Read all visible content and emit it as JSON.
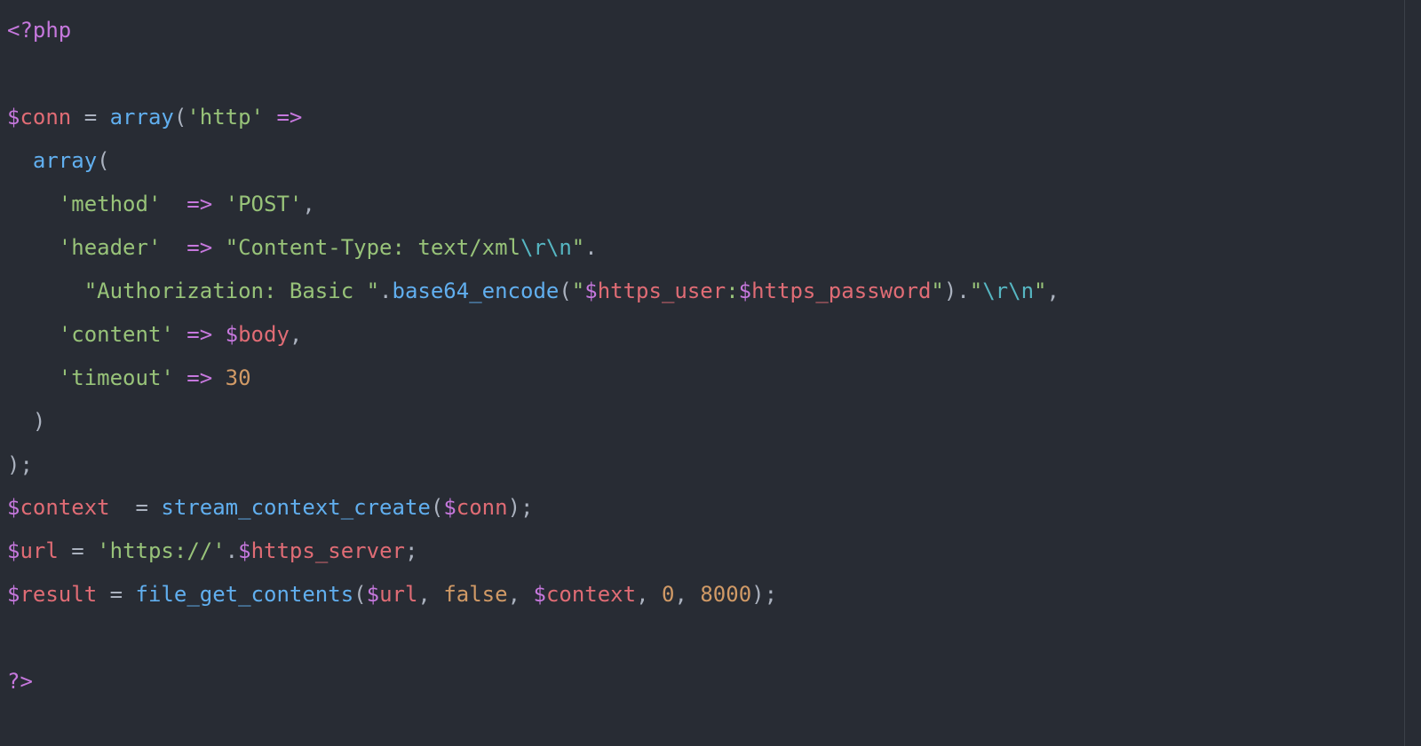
{
  "code": {
    "l1": {
      "open_tag": "<?php"
    },
    "l3": {
      "dollar": "$",
      "var": "conn",
      "eq": " = ",
      "fn": "array",
      "open": "(",
      "str": "'http'",
      "arrow": " =>"
    },
    "l4": {
      "indent": "  ",
      "fn": "array",
      "open": "("
    },
    "l5": {
      "indent": "    ",
      "str": "'method'",
      "pad": "  ",
      "arrow": "=>",
      "sp": " ",
      "val": "'POST'",
      "comma": ","
    },
    "l6": {
      "indent": "    ",
      "str": "'header'",
      "pad": "  ",
      "arrow": "=>",
      "sp": " ",
      "q": "\"",
      "body": "Content-Type: text/xml",
      "esc": "\\r\\n",
      "q2": "\"",
      "dot": "."
    },
    "l7": {
      "indent": "      ",
      "q": "\"",
      "body": "Authorization: Basic ",
      "q2": "\"",
      "dot": ".",
      "fn": "base64_encode",
      "open": "(",
      "q3": "\"",
      "d1": "$",
      "v1": "https_user",
      "colon": ":",
      "d2": "$",
      "v2": "https_password",
      "q4": "\"",
      "close": ")",
      "dot2": ".",
      "q5": "\"",
      "esc": "\\r\\n",
      "q6": "\"",
      "comma": ","
    },
    "l8": {
      "indent": "    ",
      "str": "'content'",
      "sp": " ",
      "arrow": "=>",
      "sp2": " ",
      "dollar": "$",
      "var": "body",
      "comma": ","
    },
    "l9": {
      "indent": "    ",
      "str": "'timeout'",
      "sp": " ",
      "arrow": "=>",
      "sp2": " ",
      "num": "30"
    },
    "l10": {
      "indent": "  ",
      "close": ")"
    },
    "l11": {
      "close": ");"
    },
    "l12": {
      "d1": "$",
      "v1": "context",
      "pad": "  ",
      "eq": "= ",
      "fn": "stream_context_create",
      "open": "(",
      "d2": "$",
      "v2": "conn",
      "close": ");"
    },
    "l13": {
      "d1": "$",
      "v1": "url",
      "eq": " = ",
      "str": "'https://'",
      "dot": ".",
      "d2": "$",
      "v2": "https_server",
      "semi": ";"
    },
    "l14": {
      "d1": "$",
      "v1": "result",
      "eq": " = ",
      "fn": "file_get_contents",
      "open": "(",
      "d2": "$",
      "v2": "url",
      "c1": ", ",
      "false": "false",
      "c2": ", ",
      "d3": "$",
      "v3": "context",
      "c3": ", ",
      "n1": "0",
      "c4": ", ",
      "n2": "8000",
      "close": ");"
    },
    "l16": {
      "close_tag": "?>"
    }
  }
}
